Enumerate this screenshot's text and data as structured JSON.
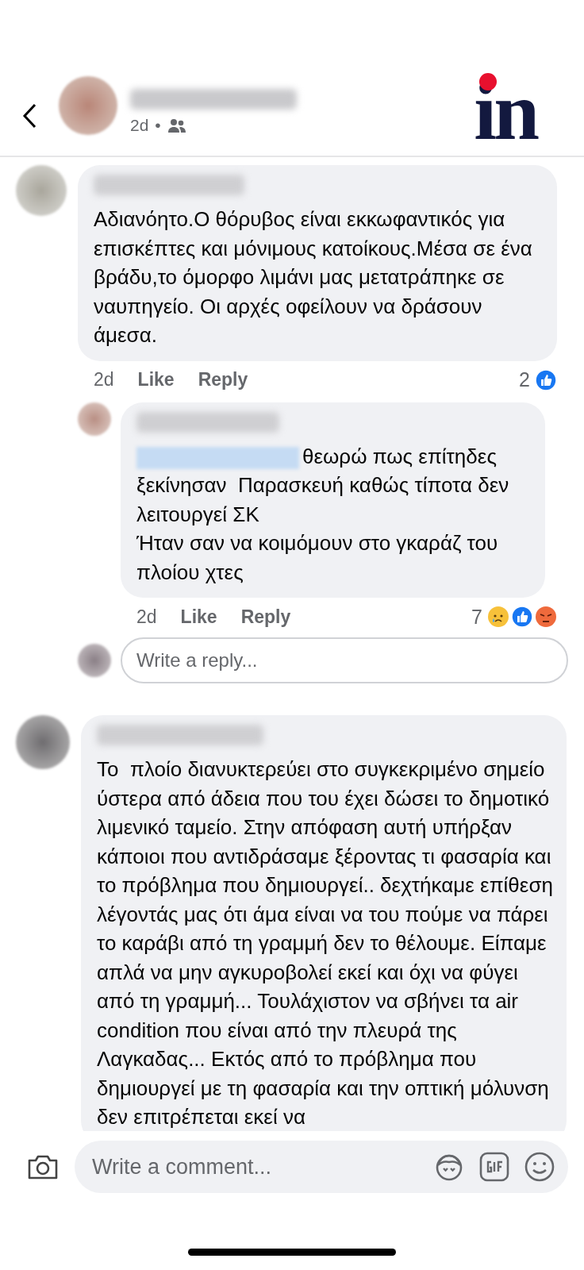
{
  "header": {
    "time": "2d",
    "separator": "•",
    "logo": "in"
  },
  "comments": [
    {
      "text": "Αδιανόητο.Ο θόρυβος είναι εκκωφαντικός για επισκέπτες και μόνιμους κατοίκους.Μέσα σε ένα βράδυ,το όμορφο λιμάνι μας μετατράπηκε σε ναυπηγείο. Οι αρχές οφείλουν να δράσουν άμεσα.",
      "time": "2d",
      "like": "Like",
      "reply": "Reply",
      "reaction_count": "2",
      "reactions": [
        {
          "kind": "like"
        }
      ],
      "replies": [
        {
          "mention": true,
          "text": "θεωρώ πως επίτηδες ξεκίνησαν  Παρασκευή καθώς τίποτα δεν λειτουργεί ΣΚ\nΉταν σαν να κοιμόμουν στο γκαράζ του πλοίου χτες",
          "time": "2d",
          "like": "Like",
          "reply": "Reply",
          "reaction_count": "7",
          "reactions": [
            {
              "kind": "sad"
            },
            {
              "kind": "like"
            },
            {
              "kind": "angry"
            }
          ]
        }
      ],
      "reply_field": {
        "placeholder": "Write a reply..."
      }
    },
    {
      "text": "Το  πλοίο διανυκτερεύει στο συγκεκριμένο σημείο ύστερα από άδεια που του έχει δώσει το δημοτικό λιμενικό ταμείο. Στην απόφαση αυτή υπήρξαν κάποιοι που αντιδράσαμε ξέροντας τι φασαρία και το πρόβλημα που δημιουργεί.. δεχτήκαμε επίθεση λέγοντάς μας ότι άμα είναι να του πούμε να πάρει το καράβι από τη γραμμή δεν το θέλουμε. Είπαμε απλά να μην αγκυροβολεί εκεί και όχι να φύγει από τη γραμμή... Τουλάχιστον να σβήνει τα air condition που είναι από την πλευρά της Λαγκαδας... Εκτός από το πρόβλημα που δημιουργεί με τη φασαρία και την οπτική μόλυνση δεν επιτρέπεται εκεί να"
    }
  ],
  "composer": {
    "placeholder": "Write a comment..."
  }
}
